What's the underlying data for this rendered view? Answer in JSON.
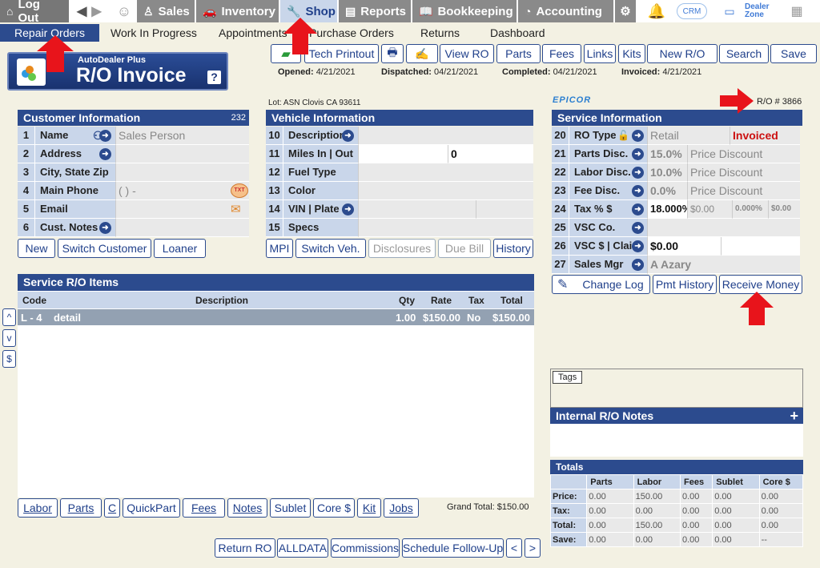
{
  "topnav": {
    "logout": "Log Out",
    "sales": "Sales",
    "inventory": "Inventory",
    "shop": "Shop",
    "reports": "Reports",
    "bookkeeping": "Bookkeeping",
    "accounting": "Accounting",
    "crm": "CRM",
    "dealer_zone_1": "Dealer",
    "dealer_zone_2": "Zone"
  },
  "subnav": {
    "repair_orders": "Repair Orders",
    "wip": "Work In Progress",
    "appointments": "Appointments",
    "purchase_orders": "Purchase Orders",
    "returns": "Returns",
    "dashboard": "Dashboard"
  },
  "logo": {
    "small": "AutoDealer Plus",
    "big": "R/O Invoice",
    "help": "?"
  },
  "toolbar": {
    "tech_printout": "Tech Printout",
    "view_ro": "View RO",
    "parts": "Parts",
    "fees": "Fees",
    "links": "Links",
    "kits": "Kits",
    "new_ro": "New R/O",
    "search": "Search",
    "save": "Save"
  },
  "dates": {
    "opened_label": "Opened:",
    "opened": "4/21/2021",
    "dispatched_label": "Dispatched:",
    "dispatched": "04/21/2021",
    "completed_label": "Completed:",
    "completed": "04/21/2021",
    "invoiced_label": "Invoiced:",
    "invoiced": "4/21/2021"
  },
  "lot": "Lot: ASN Clovis CA 93611",
  "epicor": "EPICOR",
  "ro_number": "R/O # 3866",
  "customer": {
    "title": "Customer Information",
    "count": "232",
    "rows": [
      {
        "n": "1",
        "label": "Name",
        "value": "Sales Person"
      },
      {
        "n": "2",
        "label": "Address",
        "value": ""
      },
      {
        "n": "3",
        "label": "City, State Zip",
        "value": ""
      },
      {
        "n": "4",
        "label": "Main Phone",
        "value": "(    )     -"
      },
      {
        "n": "5",
        "label": "Email",
        "value": ""
      },
      {
        "n": "6",
        "label": "Cust. Notes",
        "value": ""
      }
    ],
    "txt": "TXT",
    "buttons": {
      "new": "New",
      "switch": "Switch Customer",
      "loaner": "Loaner"
    }
  },
  "vehicle": {
    "title": "Vehicle Information",
    "rows": [
      {
        "n": "10",
        "label": "Description",
        "value": ""
      },
      {
        "n": "11",
        "label": "Miles  In | Out",
        "value": "",
        "value2": "0"
      },
      {
        "n": "12",
        "label": "Fuel Type",
        "value": ""
      },
      {
        "n": "13",
        "label": "Color",
        "value": ""
      },
      {
        "n": "14",
        "label": "VIN | Plate",
        "value": ""
      },
      {
        "n": "15",
        "label": "Specs",
        "value": ""
      }
    ],
    "buttons": {
      "mpi": "MPI",
      "switch": "Switch Veh.",
      "disclosures": "Disclosures",
      "due_bill": "Due Bill",
      "history": "History"
    }
  },
  "service": {
    "title": "Service Information",
    "rows": [
      {
        "n": "20",
        "label": "RO Type",
        "value": "Retail",
        "value2": "Invoiced"
      },
      {
        "n": "21",
        "label": "Parts Disc.",
        "value": "15.0%",
        "value2": "Price Discount"
      },
      {
        "n": "22",
        "label": "Labor Disc.",
        "value": "10.0%",
        "value2": "Price Discount"
      },
      {
        "n": "23",
        "label": "Fee Disc.",
        "value": "0.0%",
        "value2": "Price Discount"
      },
      {
        "n": "24",
        "label": "Tax % $",
        "value": "18.000%",
        "value2": "$0.00",
        "value3": "0.000%",
        "value4": "$0.00"
      },
      {
        "n": "25",
        "label": "VSC  Co.",
        "value": ""
      },
      {
        "n": "26",
        "label": "VSC $ | Claim #",
        "value": "$0.00",
        "value2": ""
      },
      {
        "n": "27",
        "label": "Sales Mgr",
        "value": "A Azary"
      }
    ],
    "buttons": {
      "change_log": "Change Log",
      "pmt_history": "Pmt History",
      "receive_money": "Receive Money"
    }
  },
  "items": {
    "title": "Service R/O Items",
    "headers": [
      "Code",
      "Description",
      "Qty",
      "Rate",
      "Tax",
      "Total"
    ],
    "rows": [
      {
        "code": "L - 4",
        "description": "detail",
        "qty": "1.00",
        "rate": "$150.00",
        "tax": "No",
        "total": "$150.00"
      }
    ]
  },
  "side": {
    "up": "^",
    "down": "v",
    "dollar": "$"
  },
  "bottom": {
    "labor": "Labor",
    "parts": "Parts",
    "c": "C",
    "quickpart": "QuickPart",
    "fees": "Fees",
    "notes": "Notes",
    "sublet": "Sublet",
    "core": "Core $",
    "kit": "Kit",
    "jobs": "Jobs",
    "grand_total": "Grand Total:  $150.00"
  },
  "footer": {
    "return_ro": "Return RO",
    "alldata": "ALLDATA",
    "commissions": "Commissions",
    "schedule": "Schedule Follow-Up",
    "prev": "<",
    "next": ">"
  },
  "tags": "Tags",
  "internal_notes": "Internal R/O Notes",
  "totals": {
    "title": "Totals",
    "headers": [
      "",
      "Parts",
      "Labor",
      "Fees",
      "Sublet",
      "Core $"
    ],
    "rows": [
      [
        "Price:",
        "0.00",
        "150.00",
        "0.00",
        "0.00",
        "0.00"
      ],
      [
        "Tax:",
        "0.00",
        "0.00",
        "0.00",
        "0.00",
        "0.00"
      ],
      [
        "Total:",
        "0.00",
        "150.00",
        "0.00",
        "0.00",
        "0.00"
      ],
      [
        "Save:",
        "0.00",
        "0.00",
        "0.00",
        "0.00",
        "--"
      ]
    ]
  },
  "colors": {
    "nav_blue": "#2c4b8e",
    "light_blue": "#c9d6ea",
    "background": "#f3f1e3",
    "arrow_red": "#e8141b",
    "invoiced_red": "#cc1111"
  }
}
